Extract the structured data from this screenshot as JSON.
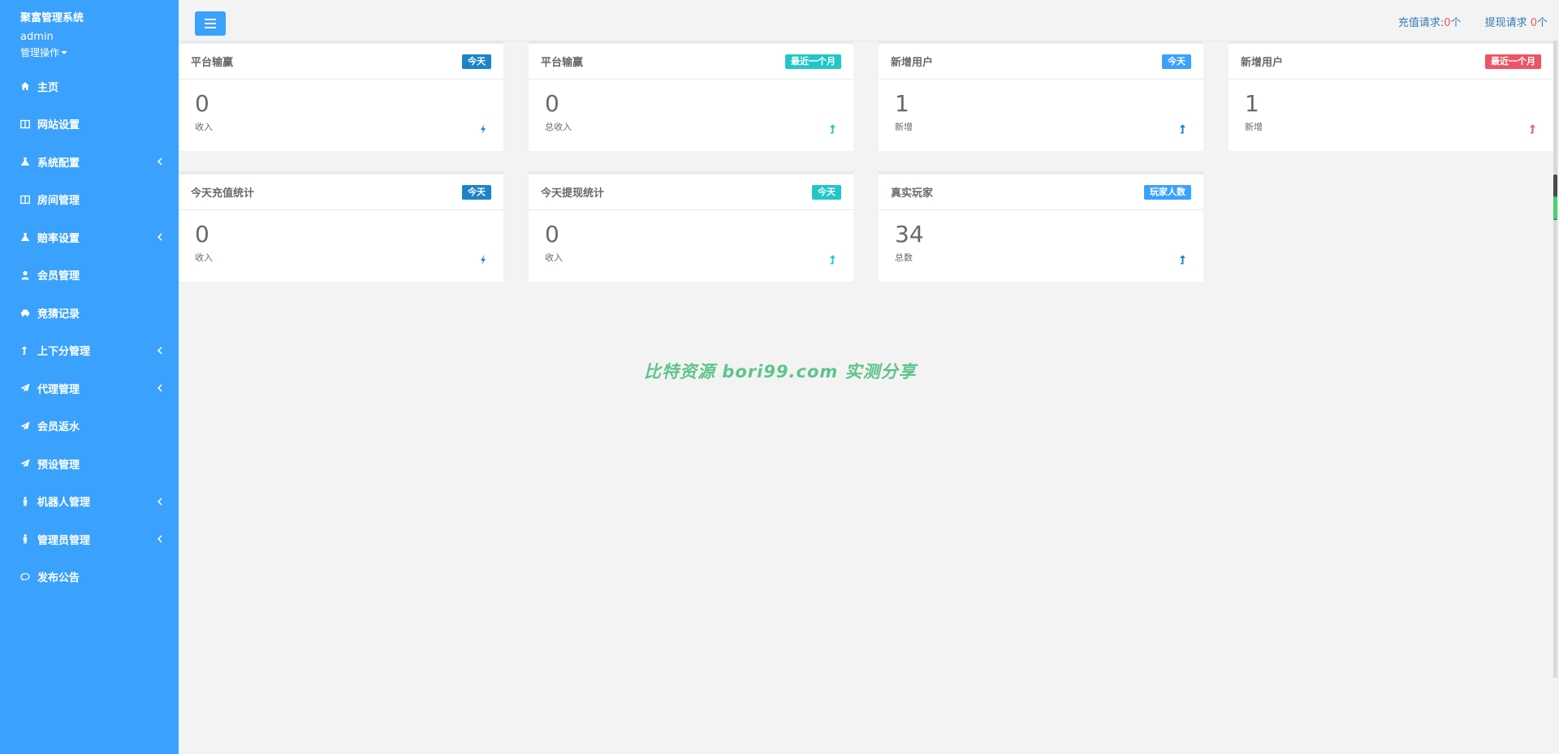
{
  "app": {
    "title": "聚富管理系统",
    "user": "admin",
    "user_menu": "管理操作"
  },
  "sidebar": {
    "items": [
      {
        "label": "主页",
        "icon": "home-icon",
        "has_children": false
      },
      {
        "label": "网站设置",
        "icon": "columns-icon",
        "has_children": false
      },
      {
        "label": "系统配置",
        "icon": "flask-icon",
        "has_children": true
      },
      {
        "label": "房间管理",
        "icon": "columns-icon",
        "has_children": false
      },
      {
        "label": "赔率设置",
        "icon": "flask-icon",
        "has_children": true
      },
      {
        "label": "会员管理",
        "icon": "user-icon",
        "has_children": false
      },
      {
        "label": "竞猜记录",
        "icon": "car-icon",
        "has_children": false
      },
      {
        "label": "上下分管理",
        "icon": "level-up-icon",
        "has_children": true
      },
      {
        "label": "代理管理",
        "icon": "paper-plane-icon",
        "has_children": true
      },
      {
        "label": "会员返水",
        "icon": "paper-plane-icon",
        "has_children": false
      },
      {
        "label": "预设管理",
        "icon": "paper-plane-icon",
        "has_children": false
      },
      {
        "label": "机器人管理",
        "icon": "male-icon",
        "has_children": true
      },
      {
        "label": "管理员管理",
        "icon": "male-icon",
        "has_children": true
      },
      {
        "label": "发布公告",
        "icon": "comment-icon",
        "has_children": false
      }
    ]
  },
  "topbar": {
    "recharge_label": "充值请求:",
    "recharge_count": "0",
    "withdraw_label": "提现请求 ",
    "withdraw_count": "0",
    "unit": "个"
  },
  "cards": [
    {
      "title": "平台输赢",
      "badge": "今天",
      "badge_color": "#1c84c6",
      "value": "0",
      "label": "收入",
      "icon": "bolt-icon",
      "icon_color": "#1c84c6"
    },
    {
      "title": "平台输赢",
      "badge": "最近一个月",
      "badge_color": "#23c6c8",
      "value": "0",
      "label": "总收入",
      "icon": "level-up-icon",
      "icon_color": "#23c6c8"
    },
    {
      "title": "新增用户",
      "badge": "今天",
      "badge_color": "#3aa1fd",
      "value": "1",
      "label": "新增",
      "icon": "level-up-icon",
      "icon_color": "#1c84c6"
    },
    {
      "title": "新增用户",
      "badge": "最近一个月",
      "badge_color": "#ed5565",
      "value": "1",
      "label": "新增",
      "icon": "level-up-icon",
      "icon_color": "#ed5565"
    },
    {
      "title": "今天充值统计",
      "badge": "今天",
      "badge_color": "#1c84c6",
      "value": "0",
      "label": "收入",
      "icon": "bolt-icon",
      "icon_color": "#1c84c6"
    },
    {
      "title": "今天提现统计",
      "badge": "今天",
      "badge_color": "#23c6c8",
      "value": "0",
      "label": "收入",
      "icon": "level-up-icon",
      "icon_color": "#23c6c8"
    },
    {
      "title": "真实玩家",
      "badge": "玩家人数",
      "badge_color": "#3aa1fd",
      "value": "34",
      "label": "总数",
      "icon": "level-up-icon",
      "icon_color": "#1c84c6"
    }
  ],
  "watermark": "比特资源 bori99.com 实测分享"
}
